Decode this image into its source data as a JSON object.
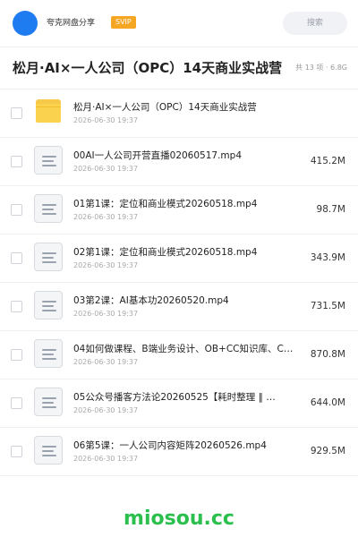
{
  "header": {
    "brand": "夸克网盘分享",
    "badge": "SVIP",
    "search_placeholder": "搜索"
  },
  "title": {
    "text": "松月·AI×一人公司（OPC）14天商业实战营",
    "meta": "共 13 项 · 6.8G"
  },
  "files": [
    {
      "name": "松月·AI×一人公司（OPC）14天商业实战营",
      "date": "2026-06-30 19:37",
      "size": "",
      "type": "folder"
    },
    {
      "name": "00AI一人公司开营直播02060517.mp4",
      "date": "2026-06-30 19:37",
      "size": "415.2M",
      "type": "video"
    },
    {
      "name": "01第1课：定位和商业模式20260518.mp4",
      "date": "2026-06-30 19:37",
      "size": "98.7M",
      "type": "video"
    },
    {
      "name": "02第1课：定位和商业模式20260518.mp4",
      "date": "2026-06-30 19:37",
      "size": "343.9M",
      "type": "video"
    },
    {
      "name": "03第2课：AI基本功20260520.mp4",
      "date": "2026-06-30 19:37",
      "size": "731.5M",
      "type": "video"
    },
    {
      "name": "04如何做课程、B端业务设计、OB+CC知识库、C…",
      "date": "2026-06-30 19:37",
      "size": "870.8M",
      "type": "video"
    },
    {
      "name": "05公众号播客方法论20260525【耗时整理 ‖ …",
      "date": "2026-06-30 19:37",
      "size": "644.0M",
      "type": "video"
    },
    {
      "name": "06第5课：一人公司内容矩阵20260526.mp4",
      "date": "2026-06-30 19:37",
      "size": "929.5M",
      "type": "video"
    }
  ],
  "footer": {
    "watermark": "miosou.cc"
  },
  "colors": {
    "accent": "#1f7cf0",
    "badge": "#f5a623",
    "folder": "#fbd24e",
    "watermark": "#2bbf4e"
  }
}
